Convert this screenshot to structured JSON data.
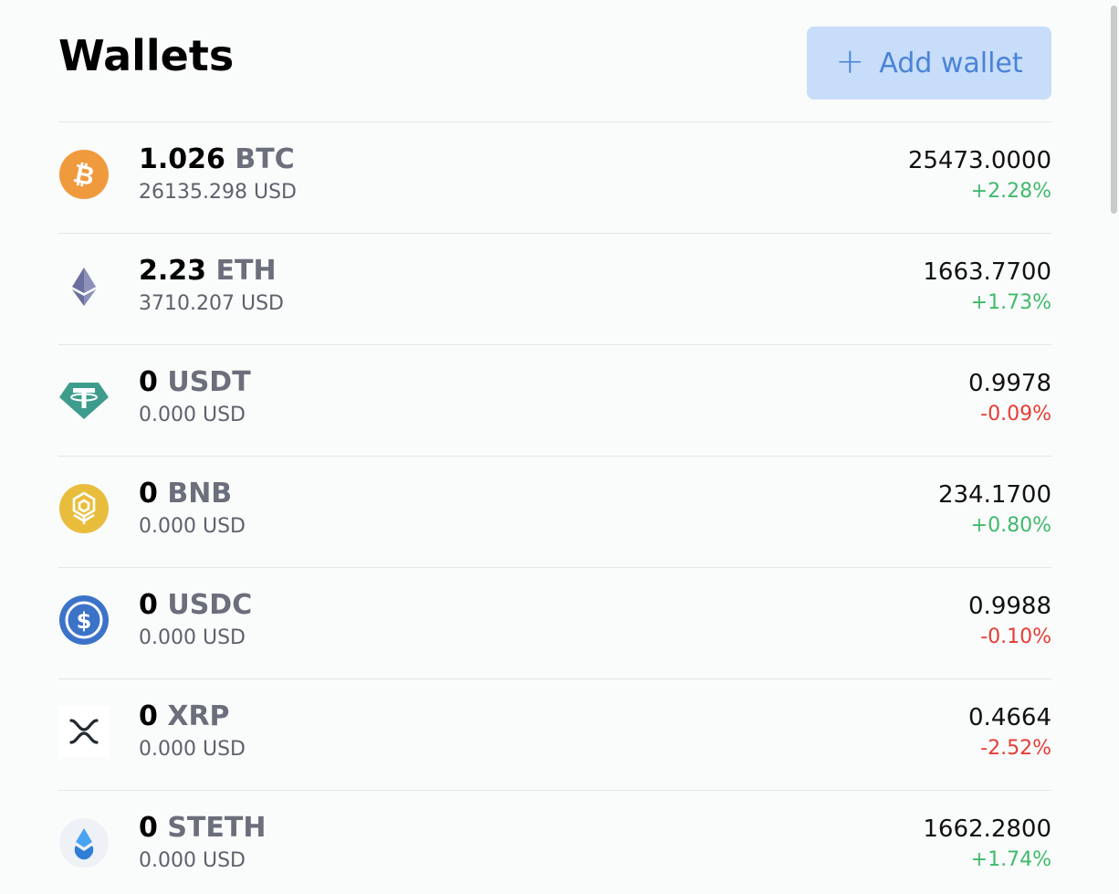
{
  "header": {
    "title": "Wallets",
    "add_button_label": "Add wallet"
  },
  "wallets": [
    {
      "amount": "1.026",
      "symbol": "BTC",
      "usd": "26135.298 USD",
      "price": "25473.0000",
      "change": "+2.28%",
      "change_direction": "up",
      "icon": "bitcoin-icon",
      "icon_color": "#f09a3e"
    },
    {
      "amount": "2.23",
      "symbol": "ETH",
      "usd": "3710.207 USD",
      "price": "1663.7700",
      "change": "+1.73%",
      "change_direction": "up",
      "icon": "ethereum-icon",
      "icon_color": "#6b6f9e"
    },
    {
      "amount": "0",
      "symbol": "USDT",
      "usd": "0.000 USD",
      "price": "0.9978",
      "change": "-0.09%",
      "change_direction": "down",
      "icon": "tether-icon",
      "icon_color": "#3e9c8c"
    },
    {
      "amount": "0",
      "symbol": "BNB",
      "usd": "0.000 USD",
      "price": "234.1700",
      "change": "+0.80%",
      "change_direction": "up",
      "icon": "bnb-icon",
      "icon_color": "#e9bd3c"
    },
    {
      "amount": "0",
      "symbol": "USDC",
      "usd": "0.000 USD",
      "price": "0.9988",
      "change": "-0.10%",
      "change_direction": "down",
      "icon": "usdc-icon",
      "icon_color": "#3b73c8"
    },
    {
      "amount": "0",
      "symbol": "XRP",
      "usd": "0.000 USD",
      "price": "0.4664",
      "change": "-2.52%",
      "change_direction": "down",
      "icon": "xrp-icon",
      "icon_color": "#23292f"
    },
    {
      "amount": "0",
      "symbol": "STETH",
      "usd": "0.000 USD",
      "price": "1662.2800",
      "change": "+1.74%",
      "change_direction": "up",
      "icon": "steth-icon",
      "icon_color": "#4aa3f0"
    }
  ],
  "colors": {
    "accent": "#4a83d8",
    "accent_bg": "#c7ddf9",
    "positive": "#3fba6b",
    "negative": "#e53d33"
  }
}
